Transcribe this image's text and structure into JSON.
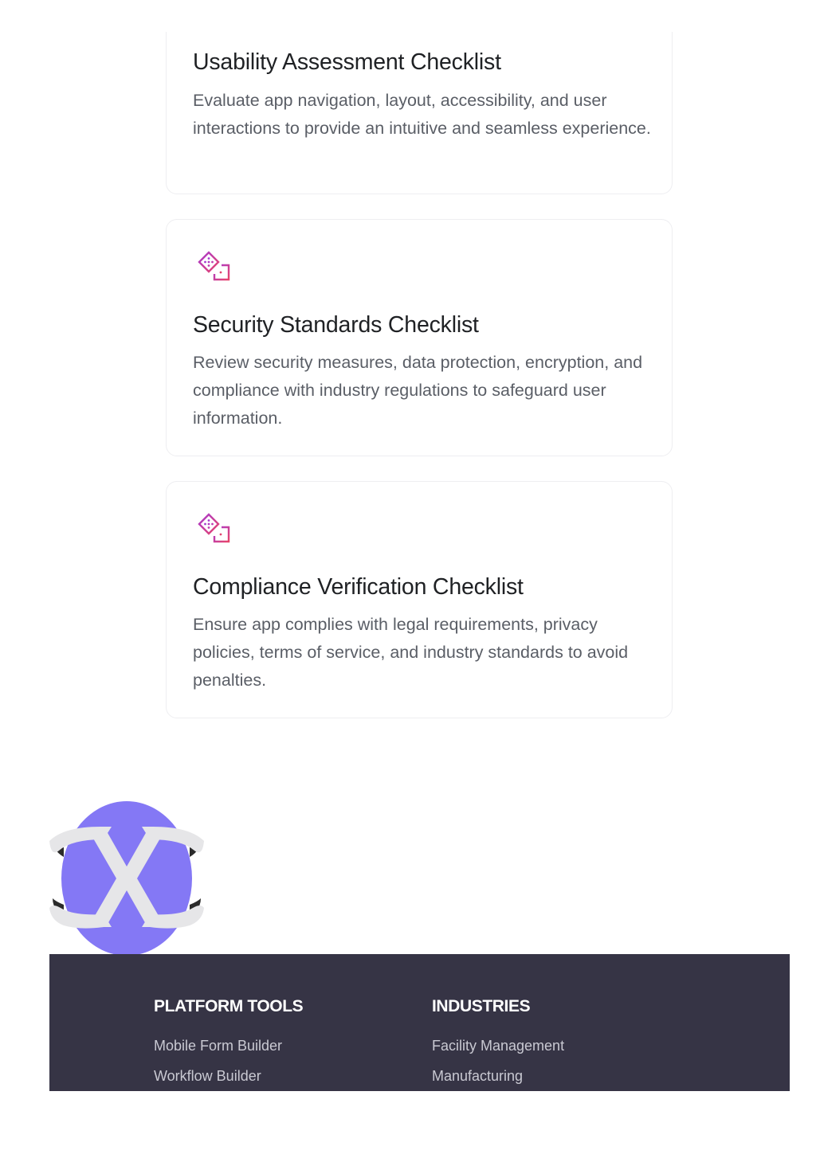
{
  "cards": [
    {
      "title": "Usability Assessment Checklist",
      "description": "Evaluate app navigation, layout, accessibility, and user interactions to provide an intuitive and seamless experience."
    },
    {
      "icon": "checklist-diamond-icon",
      "title": "Security Standards Checklist",
      "description": "Review security measures, data protection, encryption, and compliance with industry regulations to safeguard user information."
    },
    {
      "icon": "checklist-diamond-icon",
      "title": "Compliance Verification Checklist",
      "description": "Ensure app complies with legal requirements, privacy policies, terms of service, and industry standards to avoid penalties."
    }
  ],
  "logo": {
    "icon": "brand-logo",
    "colors": {
      "circle": "#8478f5",
      "ribbon": "#e6e6e8",
      "shadow": "#2b2b2b"
    }
  },
  "colors": {
    "icon_gradient_start": "#a83ad0",
    "icon_gradient_end": "#e8456a",
    "footer_bg": "#363445"
  },
  "footer": {
    "columns": [
      {
        "heading": "PLATFORM TOOLS",
        "links": [
          "Mobile Form Builder",
          "Workflow Builder"
        ]
      },
      {
        "heading": "INDUSTRIES",
        "links": [
          "Facility Management",
          "Manufacturing"
        ]
      }
    ]
  }
}
